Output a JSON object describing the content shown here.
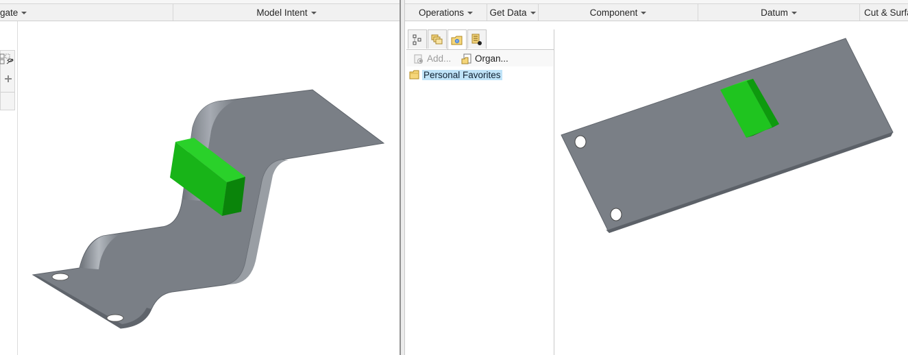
{
  "left_ribbon": {
    "groups": [
      {
        "label": "gate",
        "has_caret": true
      },
      {
        "label": "Model Intent",
        "has_caret": true
      }
    ]
  },
  "right_ribbon": {
    "groups": [
      {
        "label": "Operations",
        "has_caret": true
      },
      {
        "label": "Get Data",
        "has_caret": true
      },
      {
        "label": "Component",
        "has_caret": true
      },
      {
        "label": "Datum",
        "has_caret": true
      },
      {
        "label": "Cut & Surfa",
        "has_caret": false
      }
    ]
  },
  "navigator": {
    "tabs": [
      {
        "icon": "model-tree-icon"
      },
      {
        "icon": "layers-icon"
      },
      {
        "icon": "favorites-folder-icon"
      },
      {
        "icon": "feature-list-icon"
      }
    ],
    "toolbar": {
      "add_label": "Add...",
      "organize_label": "Organ..."
    },
    "tree": {
      "items": [
        {
          "label": "Personal Favorites",
          "icon": "folder-icon",
          "selected": true
        }
      ]
    }
  },
  "colors": {
    "part_gray": "#7a7f86",
    "feature_green": "#17b217",
    "selection_blue": "#bfe3f8"
  }
}
